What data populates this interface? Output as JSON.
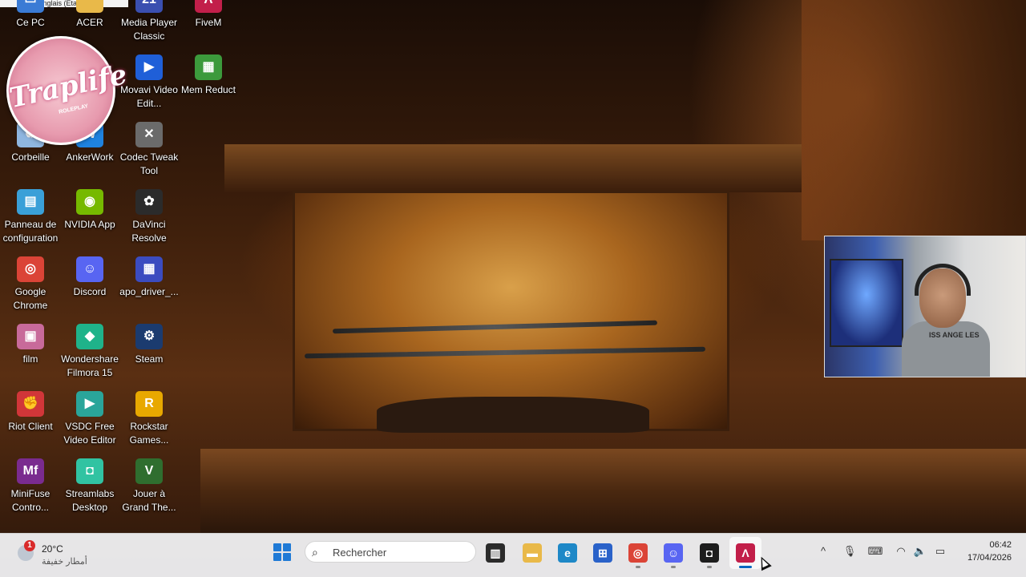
{
  "language_tip": "EN Anglais (États-Unis)",
  "logo": {
    "text": "Traplife",
    "sub": "ROLEPLAY"
  },
  "desktop_icons": [
    {
      "label": "Ce PC",
      "icon": "computer-icon",
      "color": "#3a7bd5",
      "glyph": "▭"
    },
    {
      "label": "ACER",
      "icon": "folder-icon",
      "color": "#e9b949",
      "glyph": ""
    },
    {
      "label": "Media Player Classic",
      "icon": "media-player-icon",
      "color": "#3a4fb0",
      "glyph": "21"
    },
    {
      "label": "FiveM",
      "icon": "fivem-icon",
      "color": "#c21f4a",
      "glyph": "Λ"
    },
    {
      "label": "Movavi Video Edit...",
      "icon": "movavi-icon",
      "color": "#1f5fd8",
      "glyph": "▶"
    },
    {
      "label": "Mem Reduct",
      "icon": "mem-reduct-icon",
      "color": "#3c9a3c",
      "glyph": "▦"
    },
    {
      "label": "Corbeille",
      "icon": "recycle-bin-icon",
      "color": "#8fb6e0",
      "glyph": "♻"
    },
    {
      "label": "AnkerWork",
      "icon": "ankerwork-icon",
      "color": "#1f83e0",
      "glyph": "W"
    },
    {
      "label": "Codec Tweak Tool",
      "icon": "wrench-icon",
      "color": "#6b6b6b",
      "glyph": "✕"
    },
    {
      "label": "Panneau de configuration",
      "icon": "control-panel-icon",
      "color": "#3aa0d8",
      "glyph": "▤"
    },
    {
      "label": "NVIDIA App",
      "icon": "nvidia-icon",
      "color": "#76b900",
      "glyph": "◉"
    },
    {
      "label": "DaVinci Resolve",
      "icon": "davinci-icon",
      "color": "#2b2b2b",
      "glyph": "✿"
    },
    {
      "label": "Google Chrome",
      "icon": "chrome-icon",
      "color": "#db4437",
      "glyph": "◎"
    },
    {
      "label": "Discord",
      "icon": "discord-icon",
      "color": "#5865f2",
      "glyph": "☺"
    },
    {
      "label": "apo_driver_...",
      "icon": "apo-driver-icon",
      "color": "#3b4cc0",
      "glyph": "▦"
    },
    {
      "label": "film",
      "icon": "film-folder-icon",
      "color": "#c86a9a",
      "glyph": "▣"
    },
    {
      "label": "Wondershare Filmora 15",
      "icon": "filmora-icon",
      "color": "#1fb38a",
      "glyph": "◆"
    },
    {
      "label": "Steam",
      "icon": "steam-icon",
      "color": "#1b3b6f",
      "glyph": "⚙"
    },
    {
      "label": "Riot Client",
      "icon": "riot-icon",
      "color": "#d13639",
      "glyph": "✊"
    },
    {
      "label": "VSDC Free Video Editor",
      "icon": "vsdc-icon",
      "color": "#2aa59a",
      "glyph": "▶"
    },
    {
      "label": "Rockstar Games...",
      "icon": "rockstar-icon",
      "color": "#e8a800",
      "glyph": "R"
    },
    {
      "label": "MiniFuse Contro...",
      "icon": "minifuse-icon",
      "color": "#7a2b8f",
      "glyph": "Mf"
    },
    {
      "label": "Streamlabs Desktop",
      "icon": "streamlabs-icon",
      "color": "#31c3a2",
      "glyph": "◘"
    },
    {
      "label": "Jouer à Grand The...",
      "icon": "gta-icon",
      "color": "#2f6e2f",
      "glyph": "V"
    }
  ],
  "taskbar": {
    "weather": {
      "badge": "1",
      "temperature": "20°C",
      "description": "أمطار خفيفة"
    },
    "search_placeholder": "Rechercher",
    "apps": [
      {
        "icon": "task-view-icon",
        "color": "#2b2b2b",
        "glyph": "▥"
      },
      {
        "icon": "file-explorer-icon",
        "color": "#e9b949",
        "glyph": "▬"
      },
      {
        "icon": "edge-icon",
        "color": "#1e88c7",
        "glyph": "e"
      },
      {
        "icon": "microsoft-store-icon",
        "color": "#2a62c9",
        "glyph": "⊞"
      },
      {
        "icon": "chrome-icon",
        "color": "#db4437",
        "glyph": "◎"
      },
      {
        "icon": "discord-icon",
        "color": "#5865f2",
        "glyph": "☺"
      },
      {
        "icon": "streamlabs-icon",
        "color": "#1d1d1d",
        "glyph": "◘"
      },
      {
        "icon": "fivem-icon",
        "color": "#c21f4a",
        "glyph": "Λ"
      }
    ],
    "tray": [
      {
        "icon": "chevron-up-icon",
        "glyph": "^"
      },
      {
        "icon": "microphone-icon",
        "glyph": "🎙"
      },
      {
        "icon": "keyboard-icon",
        "glyph": "⌨"
      },
      {
        "icon": "wifi-icon",
        "glyph": "◠"
      },
      {
        "icon": "volume-icon",
        "glyph": "🔈"
      },
      {
        "icon": "battery-icon",
        "glyph": "▭"
      }
    ],
    "time": "06:42",
    "date": "17/04/2026"
  },
  "webcam": {
    "shirt_text": "ISS ANGE LES"
  }
}
